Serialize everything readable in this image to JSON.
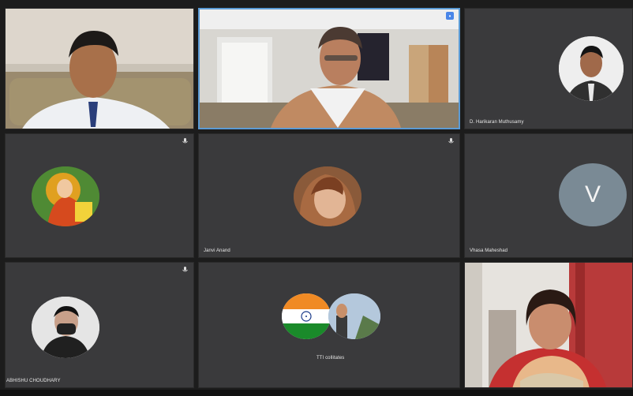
{
  "participants": [
    {
      "name": ""
    },
    {
      "name": ""
    },
    {
      "name": "D. Harikaran Muthusamy"
    },
    {
      "name": ""
    },
    {
      "name": "Janvi Anand"
    },
    {
      "name": "Vhasa Maheshad",
      "initial": "V"
    },
    {
      "name": "ABHISHU CHOUDHARY"
    },
    {
      "name": "TTI collitates"
    },
    {
      "name": ""
    }
  ],
  "colors": {
    "tile": "#3a3a3c",
    "active_border": "#5b9bd5",
    "v_avatar": "#7a8a95"
  }
}
